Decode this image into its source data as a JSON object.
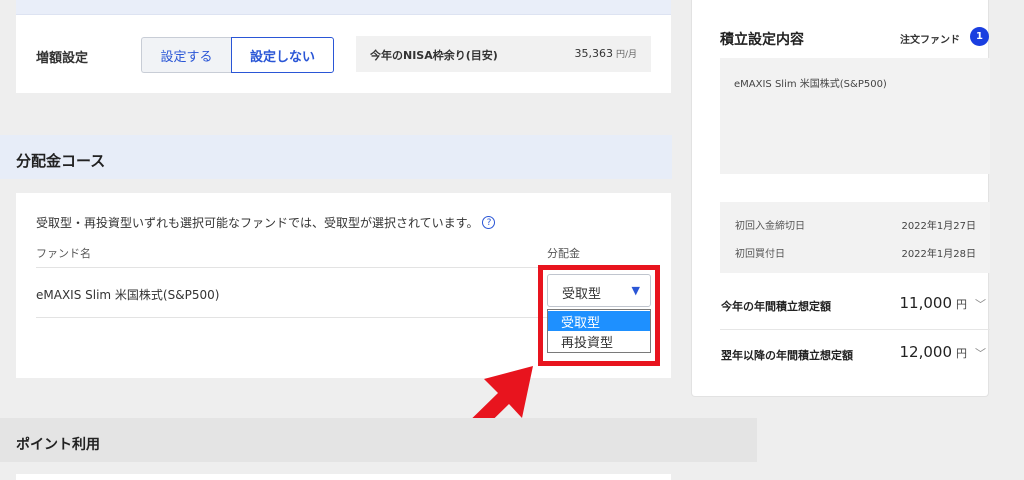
{
  "top_section": {
    "increase_setting_label": "増額設定",
    "set_button": "設定する",
    "no_set_button": "設定しない",
    "nisa_label": "今年のNISA枠余り(目安)",
    "nisa_value": "35,363",
    "nisa_unit": "円/月"
  },
  "distribution": {
    "section_title": "分配金コース",
    "note": "受取型・再投資型いずれも選択可能なファンドでは、受取型が選択されています。",
    "help_icon_label": "?",
    "col_fund": "ファンド名",
    "col_dist": "分配金",
    "fund_name": "eMAXIS Slim 米国株式(S&P500)",
    "select_value": "受取型",
    "options": [
      "受取型",
      "再投資型"
    ]
  },
  "points": {
    "section_title": "ポイント利用"
  },
  "summary_panel": {
    "title": "積立設定内容",
    "order_fund_label": "注文ファンド",
    "order_fund_count": "1",
    "fund_name": "eMAXIS Slim 米国株式(S&P500)",
    "first_deposit_label": "初回入金締切日",
    "first_deposit_date": "2022年1月27日",
    "first_purchase_label": "初回買付日",
    "first_purchase_date": "2022年1月28日",
    "this_year_label": "今年の年間積立想定額",
    "this_year_amount": "11,000",
    "next_year_label": "翌年以降の年間積立想定額",
    "next_year_amount": "12,000",
    "yen": "円"
  },
  "colors": {
    "accent_blue": "#2a56d6",
    "highlight_red": "#e8141e",
    "selected_option": "#1e90ff"
  }
}
